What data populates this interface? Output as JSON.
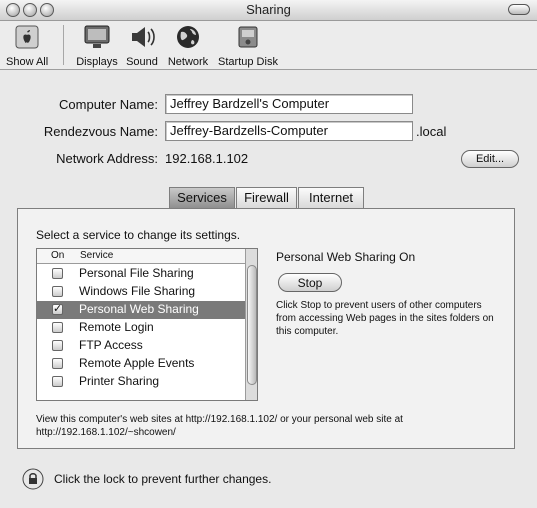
{
  "window": {
    "title": "Sharing"
  },
  "toolbar": {
    "items": [
      {
        "label": "Show All",
        "icon": "apple-icon"
      },
      {
        "label": "Displays",
        "icon": "display-icon"
      },
      {
        "label": "Sound",
        "icon": "speaker-icon"
      },
      {
        "label": "Network",
        "icon": "globe-icon"
      },
      {
        "label": "Startup Disk",
        "icon": "disk-icon"
      }
    ]
  },
  "form": {
    "computer_name_label": "Computer Name:",
    "computer_name_value": "Jeffrey Bardzell's Computer",
    "rendezvous_label": "Rendezvous Name:",
    "rendezvous_value": "Jeffrey-Bardzells-Computer",
    "rendezvous_suffix": ".local",
    "network_label": "Network Address:",
    "network_value": "192.168.1.102",
    "edit_button": "Edit..."
  },
  "tabs": [
    {
      "label": "Services",
      "active": true
    },
    {
      "label": "Firewall",
      "active": false
    },
    {
      "label": "Internet",
      "active": false
    }
  ],
  "services": {
    "instruction": "Select a service to change its settings.",
    "col_on": "On",
    "col_service": "Service",
    "items": [
      {
        "label": "Personal File Sharing",
        "checked": false,
        "selected": false
      },
      {
        "label": "Windows File Sharing",
        "checked": false,
        "selected": false
      },
      {
        "label": "Personal Web Sharing",
        "checked": true,
        "selected": true
      },
      {
        "label": "Remote Login",
        "checked": false,
        "selected": false
      },
      {
        "label": "FTP Access",
        "checked": false,
        "selected": false
      },
      {
        "label": "Remote Apple Events",
        "checked": false,
        "selected": false
      },
      {
        "label": "Printer Sharing",
        "checked": false,
        "selected": false
      }
    ],
    "status_title": "Personal Web Sharing On",
    "stop_button": "Stop",
    "description": "Click Stop to prevent users of other computers from accessing Web pages in the sites folders on this computer.",
    "footer": "View this computer's web sites at http://192.168.1.102/ or your personal web site at http://192.168.1.102/~shcowen/"
  },
  "lock": {
    "text": "Click the lock to prevent further changes."
  }
}
